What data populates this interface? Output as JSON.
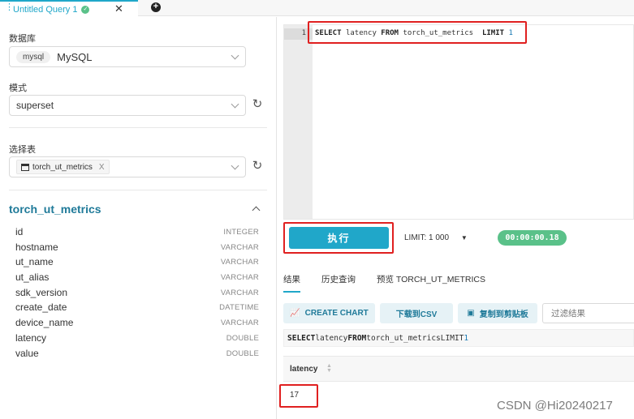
{
  "tabs": [
    {
      "title": "Untitled Query 1",
      "close": "✕"
    },
    {
      "add": "+"
    }
  ],
  "left": {
    "database_label": "数据库",
    "database_tag": "mysql",
    "database_value": "MySQL",
    "schema_label": "模式",
    "schema_value": "superset",
    "table_label": "选择表",
    "table_value": "torch_ut_metrics",
    "table_clear": "X",
    "table_title": "torch_ut_metrics",
    "columns": [
      {
        "name": "id",
        "type": "INTEGER"
      },
      {
        "name": "hostname",
        "type": "VARCHAR"
      },
      {
        "name": "ut_name",
        "type": "VARCHAR"
      },
      {
        "name": "ut_alias",
        "type": "VARCHAR"
      },
      {
        "name": "sdk_version",
        "type": "VARCHAR"
      },
      {
        "name": "create_date",
        "type": "DATETIME"
      },
      {
        "name": "device_name",
        "type": "VARCHAR"
      },
      {
        "name": "latency",
        "type": "DOUBLE"
      },
      {
        "name": "value",
        "type": "DOUBLE"
      }
    ]
  },
  "editor": {
    "line_number": "1",
    "kw_select": "SELECT",
    "col": "latency",
    "kw_from": "FROM",
    "table": "torch_ut_metrics",
    "kw_limit": "LIMIT",
    "limit_value": "1"
  },
  "run": {
    "button_label": "执行",
    "limit_label": "LIMIT:",
    "limit_value": "1 000",
    "timer": "00:00:00.18"
  },
  "results": {
    "tabs": [
      "结果",
      "历史查询",
      "预览 TORCH_UT_METRICS"
    ],
    "create_chart": "CREATE CHART",
    "download_csv": "下载到CSV",
    "copy_clipboard": "复制到剪贴板",
    "filter_placeholder": "过滤结果",
    "executed_sql": {
      "kw_select": "SELECT",
      "col": "latency",
      "kw_from": "FROM",
      "table": "torch_ut_metrics",
      "kw_limit": "LIMIT",
      "limit_value": "1"
    },
    "column_header": "latency",
    "rows": [
      "17"
    ]
  },
  "watermark": "CSDN @Hi20240217",
  "colors": {
    "accent": "#20a7c9",
    "success": "#5ac189",
    "highlight": "#e02020"
  }
}
